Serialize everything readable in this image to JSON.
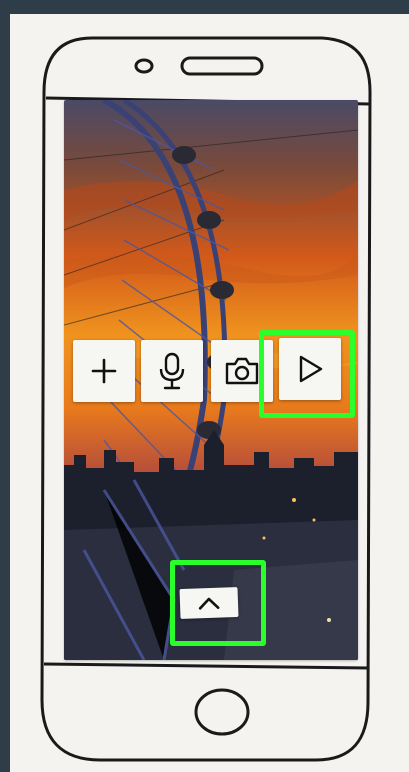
{
  "screen": {
    "background_image": "london-eye-sunset-photo",
    "toolbar": [
      {
        "id": "add",
        "icon": "plus-icon",
        "highlighted": false
      },
      {
        "id": "voice",
        "icon": "microphone-icon",
        "highlighted": false
      },
      {
        "id": "camera",
        "icon": "camera-icon",
        "highlighted": false
      },
      {
        "id": "play",
        "icon": "play-icon",
        "highlighted": true
      }
    ],
    "bottom_control": {
      "icon": "chevron-up-icon",
      "highlighted": true
    }
  },
  "colors": {
    "highlight": "#2bff2b",
    "background": "#2e3d48",
    "paper": "#f4f3f0",
    "sketch_line": "#1a1a1a"
  }
}
